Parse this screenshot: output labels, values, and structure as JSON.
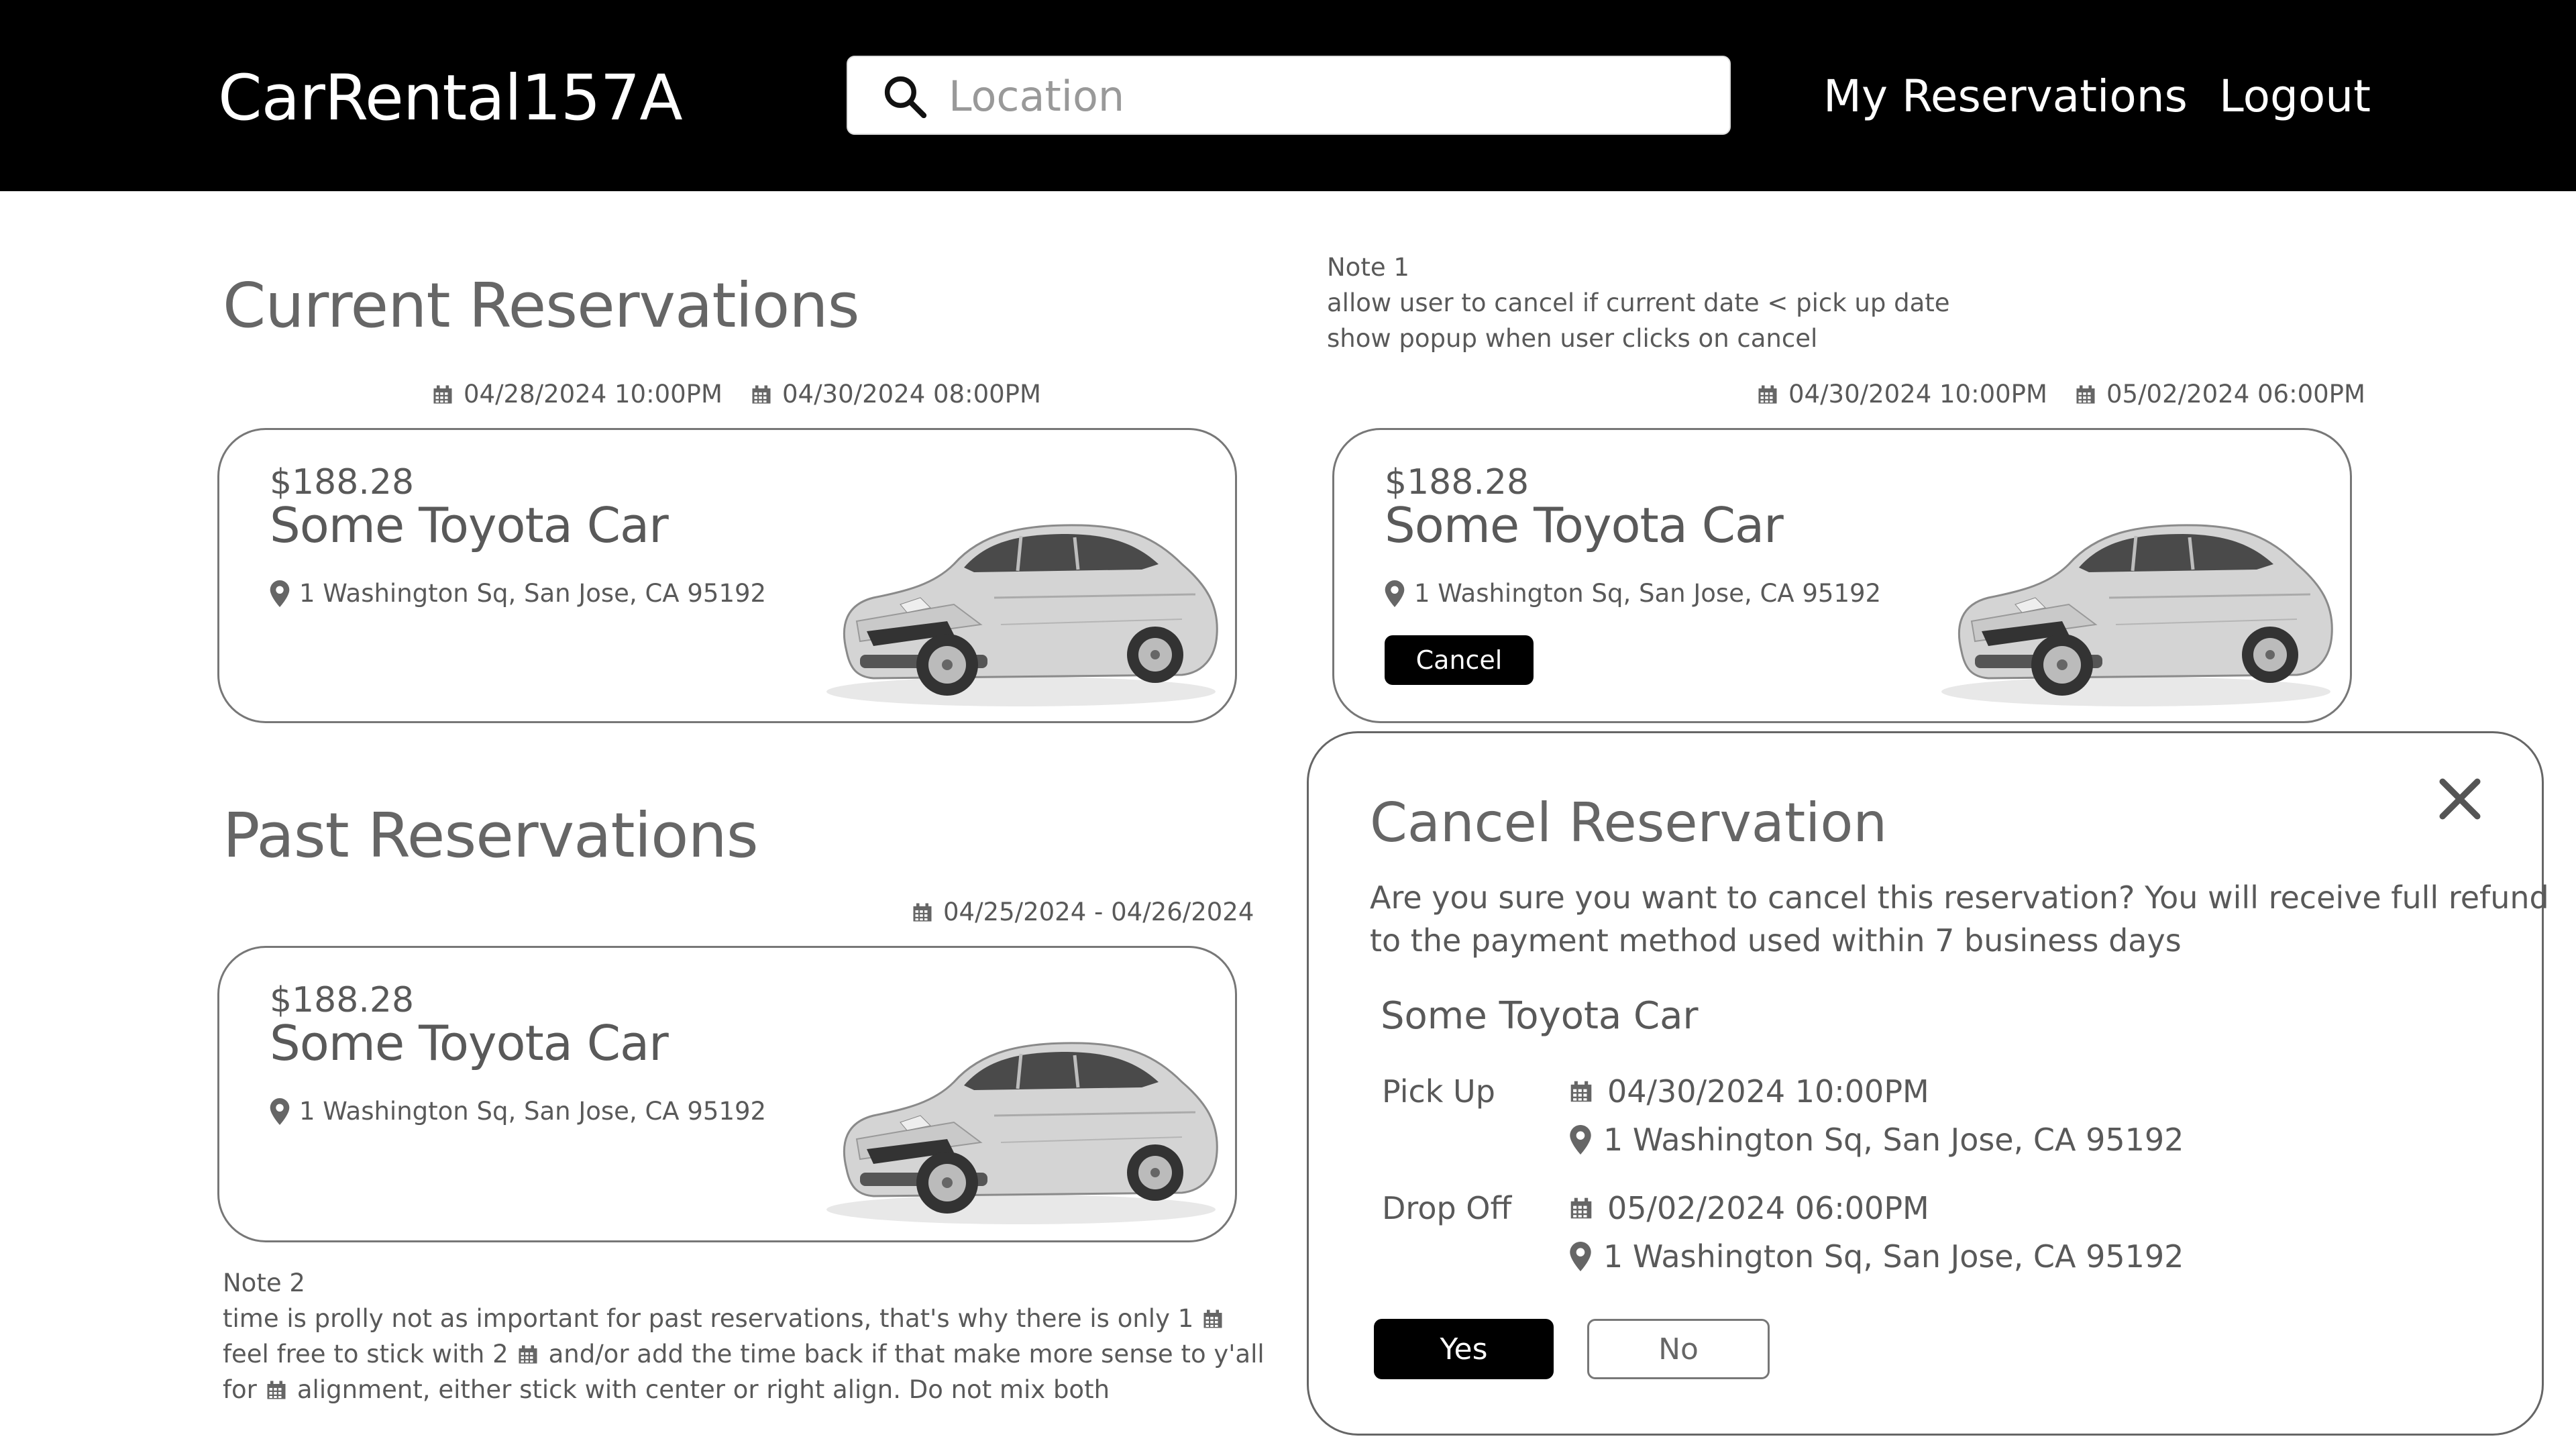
{
  "header": {
    "logo": "CarRental157A",
    "search_placeholder": "Location",
    "nav": {
      "reservations": "My Reservations",
      "logout": "Logout"
    }
  },
  "current": {
    "title": "Current Reservations",
    "card1": {
      "pickup": "04/28/2024 10:00PM",
      "dropoff": "04/30/2024 08:00PM",
      "price": "$188.28",
      "car": "Some Toyota Car",
      "address": "1 Washington Sq,  San Jose, CA 95192"
    },
    "card2": {
      "pickup": "04/30/2024 10:00PM",
      "dropoff": "05/02/2024 06:00PM",
      "price": "$188.28",
      "car": "Some Toyota Car",
      "address": "1 Washington Sq,  San Jose, CA 95192",
      "cancel_label": "Cancel"
    }
  },
  "note1": {
    "title": "Note 1",
    "lines": [
      "allow user to cancel if current date < pick up date",
      "show popup when user clicks on cancel"
    ]
  },
  "past": {
    "title": "Past Reservations",
    "card": {
      "dates": "04/25/2024 - 04/26/2024",
      "price": "$188.28",
      "car": "Some Toyota Car",
      "address": "1 Washington Sq,  San Jose, CA 95192"
    }
  },
  "note2": {
    "title": "Note 2",
    "line1": "time is prolly not as important for past reservations, that's why there is only 1",
    "line2a": "feel free to stick with 2",
    "line2b": "and/or add the time back if that make more sense to y'all",
    "line3a": "for",
    "line3b": "alignment, either stick with center or right align. Do not mix both"
  },
  "modal": {
    "title": "Cancel Reservation",
    "message_line1": "Are you sure you want to cancel this reservation? You will receive full refund",
    "message_line2": "to the payment method used within 7 business days",
    "car": "Some Toyota Car",
    "pickup_label": "Pick Up",
    "pickup_date": "04/30/2024 10:00PM",
    "pickup_address": "1 Washington Sq,  San Jose, CA 95192",
    "dropoff_label": "Drop Off",
    "dropoff_date": "05/02/2024 06:00PM",
    "dropoff_address": "1 Washington Sq,  San Jose, CA 95192",
    "yes_label": "Yes",
    "no_label": "No"
  },
  "icons": [
    "search-icon",
    "calendar-icon",
    "map-pin-icon",
    "car-image",
    "close-icon"
  ]
}
